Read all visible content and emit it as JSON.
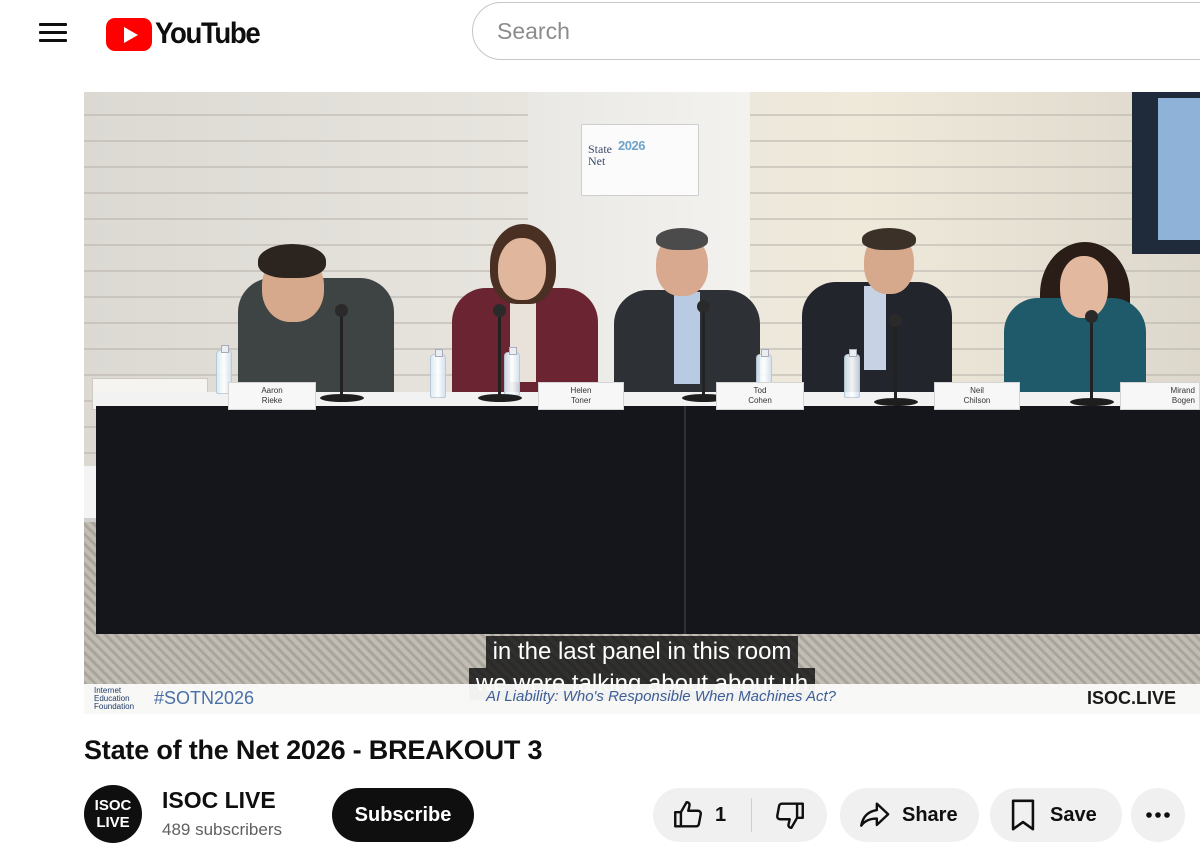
{
  "header": {
    "logo_text": "YouTube",
    "search_placeholder": "Search"
  },
  "video": {
    "sign_text_a": "State\nNet",
    "sign_text_b": "2026",
    "nameplates": [
      "Aaron\nRieke",
      "Helen\nToner",
      "Tod\nCohen",
      "Neil\nChilson",
      "Mirand\nBogen"
    ],
    "captions": [
      "in the last panel in this room",
      "we were talking about about uh"
    ],
    "overlay": {
      "org": "Internet\nEducation\nFoundation",
      "hashtag": "#SOTN2026",
      "session_title": "AI Liability: Who's Responsible When Machines Act?",
      "watermark": "ISOC.LIVE"
    }
  },
  "title": "State of the Net 2026 - BREAKOUT 3",
  "channel": {
    "avatar_text": "ISOC\nLIVE",
    "name": "ISOC LIVE",
    "subscribers": "489 subscribers",
    "subscribe_label": "Subscribe"
  },
  "actions": {
    "like_count": "1",
    "share_label": "Share",
    "save_label": "Save"
  },
  "colors": {
    "brand_red": "#ff0000",
    "subscribe_bg": "#0f0f0f",
    "pill_bg": "#f0f0f0"
  },
  "icons": [
    "menu-icon",
    "youtube-logo-icon",
    "like-icon",
    "dislike-icon",
    "share-icon",
    "save-icon",
    "more-icon"
  ]
}
